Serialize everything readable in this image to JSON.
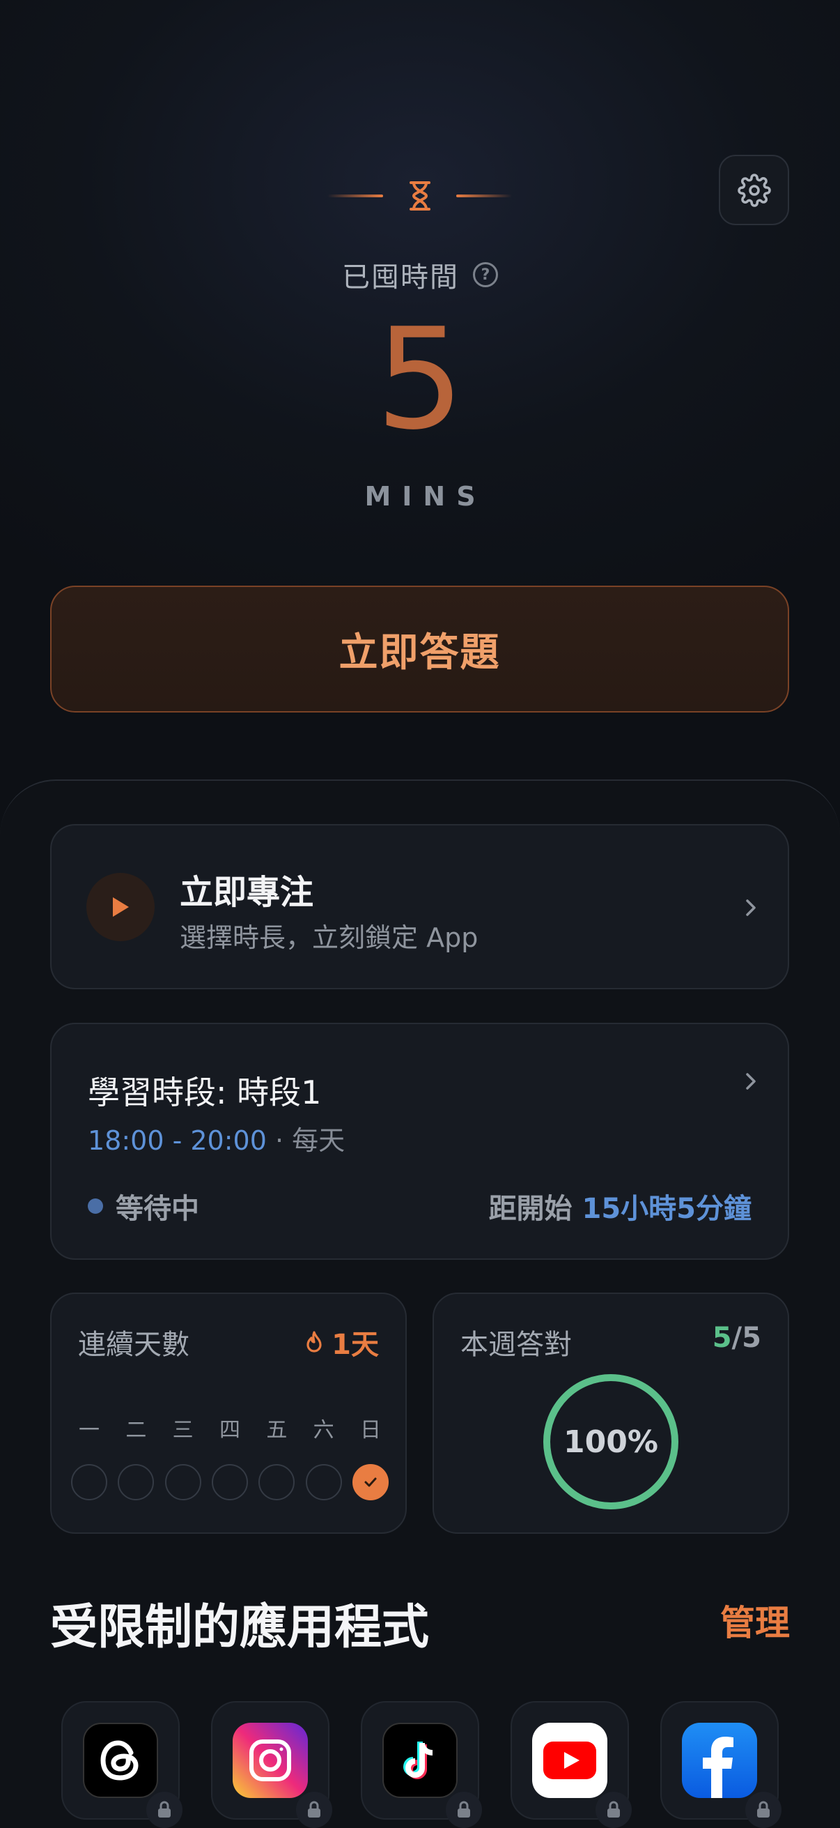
{
  "header": {
    "title": "已囤時間",
    "value": "5",
    "unit": "MINS",
    "answer_button": "立即答題"
  },
  "focus": {
    "title": "立即專注",
    "subtitle": "選擇時長，立刻鎖定 App"
  },
  "session": {
    "title": "學習時段: 時段1",
    "time_range": "18:00 - 20:00",
    "separator": " · ",
    "repeat": "每天",
    "status": "等待中",
    "countdown_label": "距開始 ",
    "countdown_value": "15小時5分鐘"
  },
  "streak": {
    "label": "連續天數",
    "value": "1天",
    "days": [
      {
        "label": "一",
        "done": false
      },
      {
        "label": "二",
        "done": false
      },
      {
        "label": "三",
        "done": false
      },
      {
        "label": "四",
        "done": false
      },
      {
        "label": "五",
        "done": false
      },
      {
        "label": "六",
        "done": false
      },
      {
        "label": "日",
        "done": true
      }
    ]
  },
  "weekly": {
    "label": "本週答對",
    "correct": "5",
    "slash": "/",
    "total": "5",
    "percent_text": "100%",
    "progress": 1.0
  },
  "restricted": {
    "title": "受限制的應用程式",
    "manage_label": "管理",
    "apps": [
      "threads-icon",
      "instagram-icon",
      "tiktok-icon",
      "youtube-icon",
      "facebook-icon"
    ]
  },
  "colors": {
    "accent": "#e97d42",
    "blue": "#5e92d8",
    "green": "#5bc08a"
  }
}
